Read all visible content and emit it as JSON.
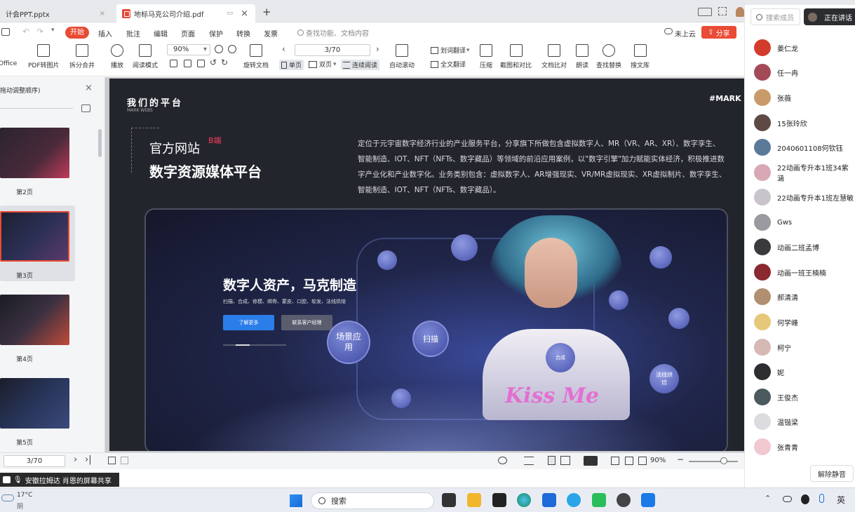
{
  "tabs": {
    "tab1": "计会PPT.pptx",
    "tab2": "地标马克公司介绍.pdf",
    "plus": "+"
  },
  "menu": {
    "start": "开始",
    "items": [
      "插入",
      "批注",
      "编辑",
      "页面",
      "保护",
      "转换",
      "发票"
    ],
    "search": "查找功能、文档内容",
    "cloud": "未上云",
    "share": "分享"
  },
  "toolbar": {
    "office": "Office",
    "pdf_to_img": "PDF转图片",
    "split_merge": "拆分合并",
    "play": "播放",
    "read_mode": "阅读模式",
    "zoom": "90%",
    "rotate": "旋转文档",
    "page": "3/70",
    "single": "单页",
    "double": "双页",
    "continuous": "连续阅读",
    "auto_scroll": "自动滚动",
    "word_translate": "划词翻译",
    "full_translate": "全文翻译",
    "compress": "压缩",
    "screenshot_compare": "截图和对比",
    "doc_compare": "文档比对",
    "read_aloud": "朗读",
    "find_replace": "查找替换",
    "search_lib": "搜文库"
  },
  "sidebar": {
    "header": "拖动调整顺序)",
    "pages": [
      "第2页",
      "第3页",
      "第4页",
      "第5页"
    ]
  },
  "slide": {
    "heading": "我们的平台",
    "sub": "MARK WEBS",
    "tag": "#MARK",
    "title1": "官方网站",
    "badge": "B端",
    "title2": "数字资源媒体平台",
    "paragraph": "定位于元宇宙数字经济行业的产业服务平台，分享旗下所做包含虚拟数字人、MR（VR、AR、XR）、数字孪生、智能制造、IOT、NFT（NFTs、数字藏品）等领域的前沿应用案例，以\"数字引擎\"加力赋能实体经济，积极推进数字产业化和产业数字化。业务类别包含：虚拟数字人、AR增强现实、VR/MR虚拟现实、XR虚拟制片、数字孪生、智能制造、IOT、NFT（NFTs、数字藏品）。",
    "hero_title": "数字人资产，马克制造",
    "hero_sub": "扫描、合成、修模、绑骨、蒙皮、口腔、软发、法线烘焙",
    "btn1": "了解更多",
    "btn2": "联系客户经理",
    "bubble1": "场景应用",
    "bubble2": "扫描",
    "bubble3": "合成",
    "bubble4": "法线烘焙",
    "kiss": "Kiss Me"
  },
  "bottom": {
    "page": "3/70",
    "zoom": "90%"
  },
  "panel": {
    "search": "搜索成员",
    "speaking": "正在讲话",
    "members": [
      "姜仁龙",
      "任一冉",
      "张薇",
      "15张玲欣",
      "2040601108何钦钰",
      "22动画专升本1班34紫涵",
      "22动画专升本1班左慧敏",
      "Gws",
      "动画二班孟博",
      "动画一班王楠楠",
      "郝清清",
      "何学峰",
      "柯宁",
      "妮",
      "王俊杰",
      "温锴梁",
      "张青青"
    ],
    "unmute": "解除静音"
  },
  "share_bar": "安徽拉姆达 肖恩的屏幕共享",
  "taskbar": {
    "temp": "17°C",
    "weather": "阴",
    "search": "搜索",
    "lang": "英"
  }
}
